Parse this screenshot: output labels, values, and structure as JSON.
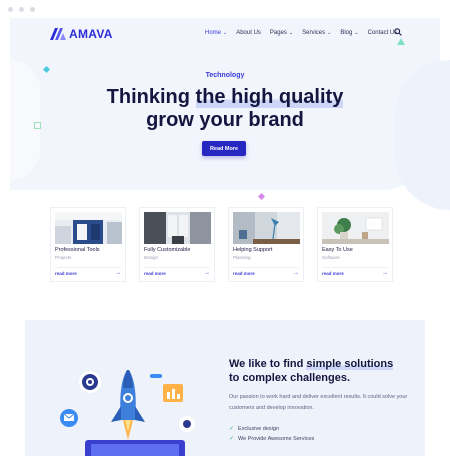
{
  "brand": {
    "name": "AMAVA",
    "accent": "#3a3ad8",
    "button_color": "#2727c2"
  },
  "nav": {
    "items": [
      {
        "label": "Home",
        "caret": true,
        "active": true
      },
      {
        "label": "About Us",
        "caret": false
      },
      {
        "label": "Pages",
        "caret": true
      },
      {
        "label": "Services",
        "caret": true
      },
      {
        "label": "Blog",
        "caret": true
      },
      {
        "label": "Contact Us",
        "caret": false
      }
    ],
    "search_icon": "search-icon"
  },
  "hero": {
    "tagline": "Technology",
    "line1_plain": "Thinking ",
    "line1_highlight": "the high quality",
    "line2": "grow your brand",
    "cta_label": "Read More"
  },
  "cards": [
    {
      "title": "Professional Tools",
      "subtitle": "Projects",
      "more": "read more",
      "image": "blue-interior"
    },
    {
      "title": "Fully Customizable",
      "subtitle": "Design",
      "more": "read more",
      "image": "window-room"
    },
    {
      "title": "Helping Support",
      "subtitle": "Planning",
      "more": "read more",
      "image": "desk-lamp"
    },
    {
      "title": "Easy To Use",
      "subtitle": "Software",
      "more": "read more",
      "image": "plant-shelf"
    }
  ],
  "section2": {
    "title_plain1": "We like to find ",
    "title_highlight": "simple solutions",
    "title_line2": "to complex challenges.",
    "description": "Our passion to work hard and deliver excellent results. It could solve your customers and develop innovation.",
    "checks": [
      "Exclusive design",
      "We Provide Awesome Services"
    ]
  }
}
